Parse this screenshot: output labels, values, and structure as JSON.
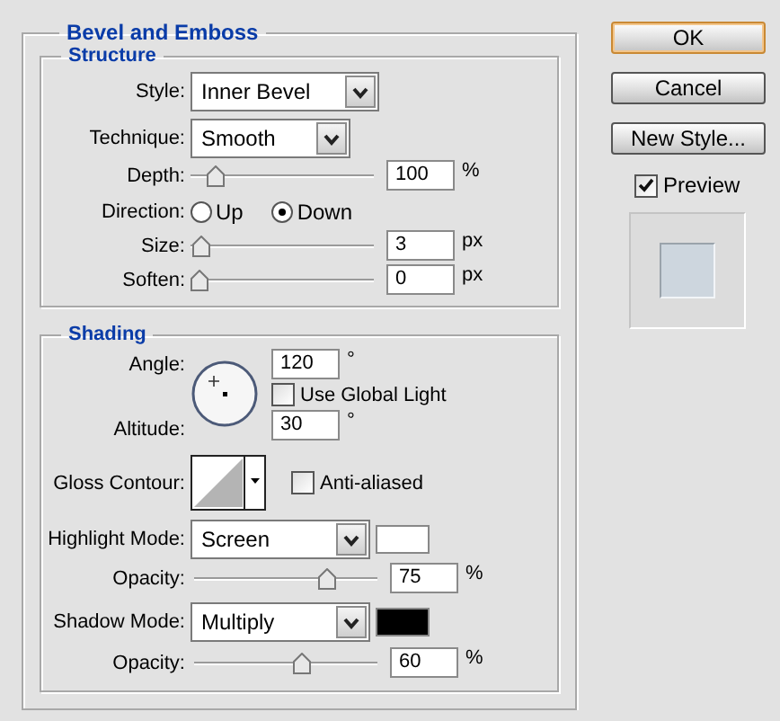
{
  "panel": {
    "title": "Bevel and Emboss"
  },
  "structure": {
    "title": "Structure",
    "style": {
      "label": "Style:",
      "value": "Inner Bevel"
    },
    "technique": {
      "label": "Technique:",
      "value": "Smooth"
    },
    "depth": {
      "label": "Depth:",
      "value": "100",
      "unit": "%",
      "level": 0.1
    },
    "direction": {
      "label": "Direction:",
      "options": [
        {
          "label": "Up",
          "selected": false
        },
        {
          "label": "Down",
          "selected": true
        }
      ]
    },
    "size": {
      "label": "Size:",
      "value": "3",
      "unit": "px",
      "level": 0.01
    },
    "soften": {
      "label": "Soften:",
      "value": "0",
      "unit": "px",
      "level": 0
    }
  },
  "shading": {
    "title": "Shading",
    "angle": {
      "label": "Angle:",
      "value": "120",
      "unit": "°"
    },
    "global_light": {
      "label": "Use Global Light",
      "checked": false
    },
    "altitude": {
      "label": "Altitude:",
      "value": "30",
      "unit": "°"
    },
    "gloss_contour": {
      "label": "Gloss Contour:"
    },
    "anti_aliased": {
      "label": "Anti-aliased",
      "checked": false
    },
    "highlight_mode": {
      "label": "Highlight Mode:",
      "value": "Screen",
      "color": "#ffffff"
    },
    "highlight_opacity": {
      "label": "Opacity:",
      "value": "75",
      "unit": "%",
      "level": 0.75
    },
    "shadow_mode": {
      "label": "Shadow Mode:",
      "value": "Multiply",
      "color": "#000000"
    },
    "shadow_opacity": {
      "label": "Opacity:",
      "value": "60",
      "unit": "%",
      "level": 0.6
    }
  },
  "buttons": [
    {
      "label": "OK",
      "default": true
    },
    {
      "label": "Cancel",
      "default": false
    },
    {
      "label": "New Style...",
      "default": false
    }
  ],
  "preview": {
    "label": "Preview",
    "checked": true
  }
}
